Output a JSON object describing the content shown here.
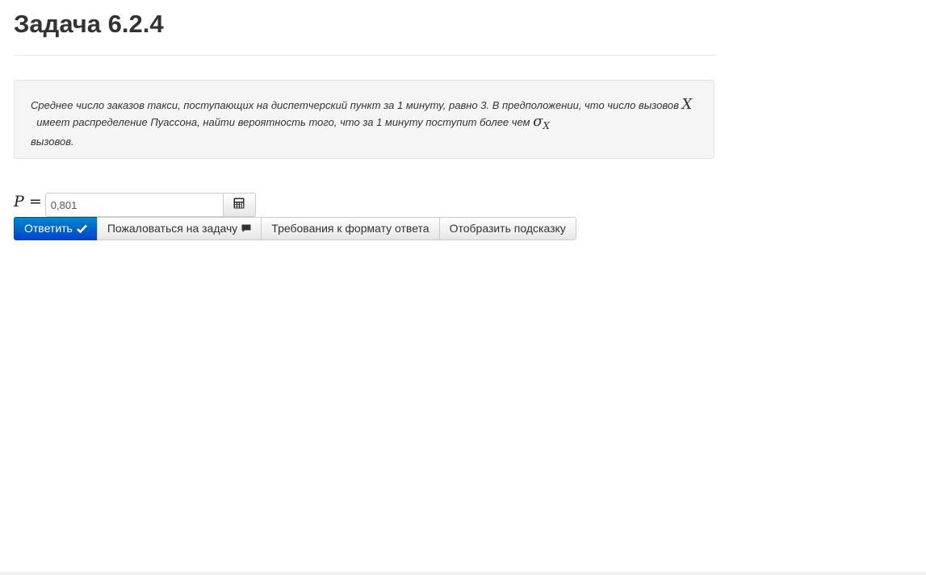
{
  "page": {
    "title": "Задача 6.2.4"
  },
  "problem": {
    "text_part1": "Среднее число заказов такси, поступающих на диспетчерский пункт за 1 минуту, равно 3. В предположении, что число вызовов",
    "math_var": "X",
    "text_part2": "имеет распределение Пуассона, найти вероятность того, что за 1 минуту поступит более чем",
    "math_sigma": "σ",
    "math_sigma_sub": "X",
    "text_part3": "вызовов."
  },
  "answer": {
    "label_var": "P",
    "label_eq": "=",
    "value": "0,801",
    "calculator_icon": "calculator-icon"
  },
  "buttons": {
    "submit": "Ответить",
    "submit_icon": "checkmark-icon",
    "report": "Пожаловаться на задачу",
    "report_icon": "comment-icon",
    "format": "Требования к формату ответа",
    "hint": "Отобразить подсказку"
  },
  "colors": {
    "primary_button": "#0055cc",
    "well_background": "#f5f5f5"
  }
}
